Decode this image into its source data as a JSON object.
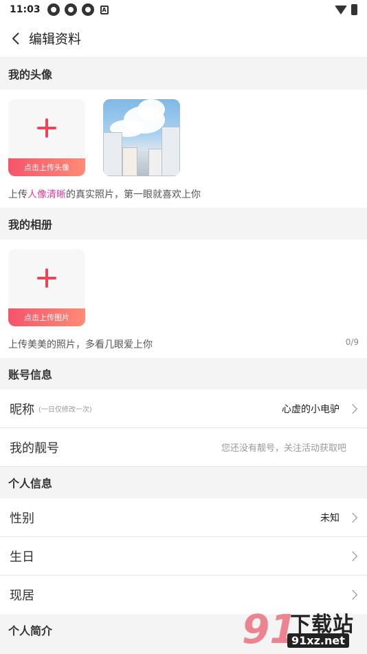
{
  "status_bar": {
    "time": "11:03",
    "a_label": "A"
  },
  "header": {
    "title": "编辑资料"
  },
  "avatar_section": {
    "title": "我的头像",
    "upload_label": "点击上传头像",
    "hint_prefix": "上传",
    "hint_highlight": "人像清晰",
    "hint_suffix": "的真实照片，第一眼就喜欢上你"
  },
  "album_section": {
    "title": "我的相册",
    "upload_label": "点击上传图片",
    "hint": "上传美美的照片，多看几眼爱上你",
    "count": "0/9"
  },
  "account_section": {
    "title": "账号信息",
    "nickname_label": "昵称",
    "nickname_note": "(一日仅修改一次)",
    "nickname_value": "心虚的小电驴",
    "pretty_id_label": "我的靓号",
    "pretty_id_value": "您还没有靓号，关注活动获取吧"
  },
  "personal_section": {
    "title": "个人信息",
    "gender_label": "性别",
    "gender_value": "未知",
    "birthday_label": "生日",
    "residence_label": "现居"
  },
  "bio_section": {
    "title": "个人简介"
  },
  "watermark": {
    "number": "91",
    "brand": "下载站",
    "url": "91xz.net"
  },
  "colors": {
    "accent": "#f0435a",
    "highlight": "#ee3c9a"
  }
}
